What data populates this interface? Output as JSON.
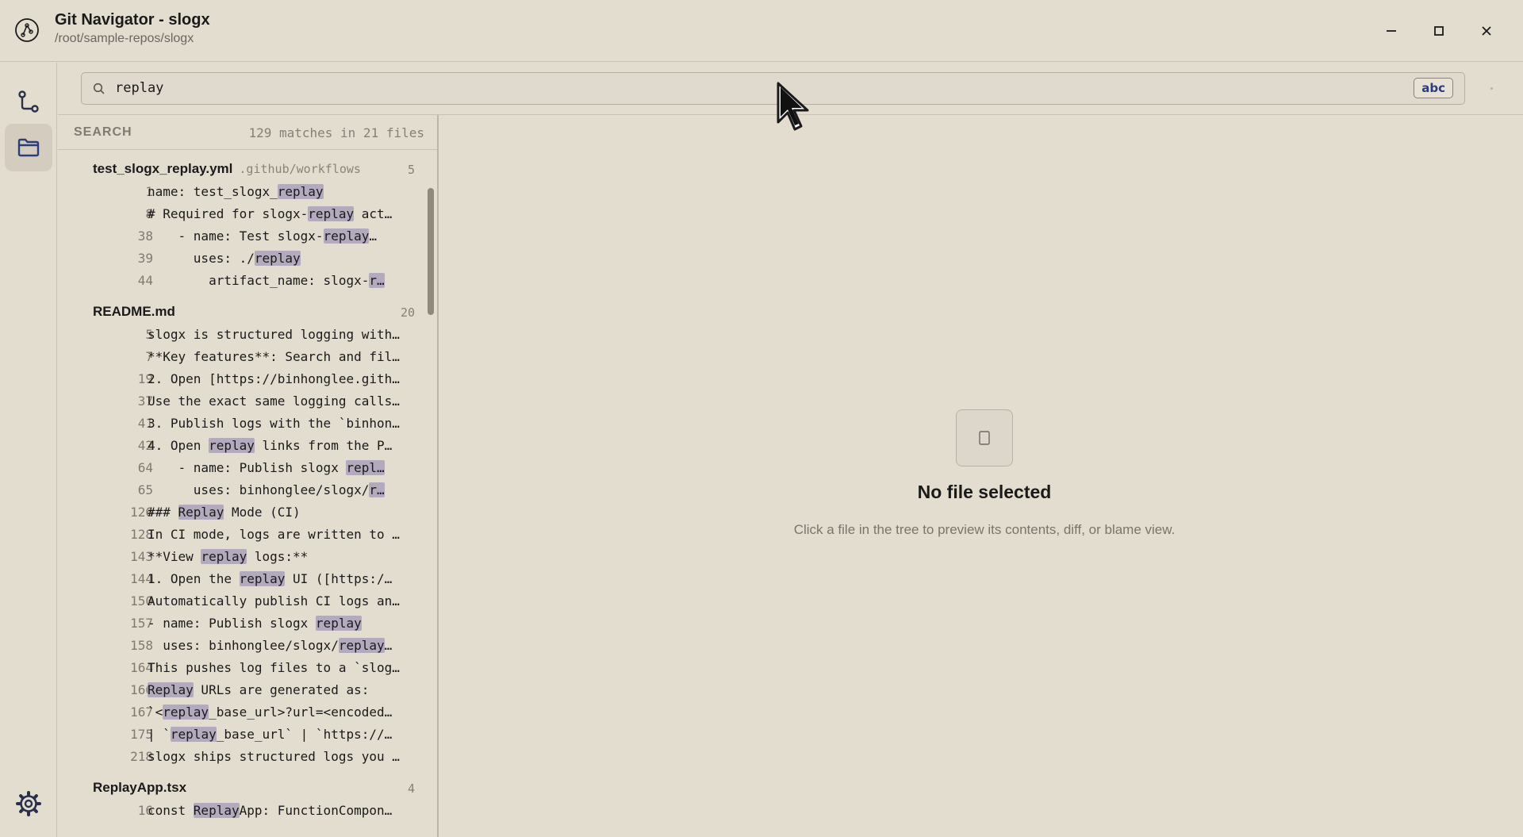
{
  "window": {
    "title": "Git Navigator - slogx",
    "path": "/root/sample-repos/slogx",
    "logo_icon": "git-navigator-logo-icon"
  },
  "rail": {
    "items": [
      {
        "icon": "git-branch-icon",
        "active": false
      },
      {
        "icon": "folder-icon",
        "active": true
      },
      {
        "icon": "gear-icon",
        "active": false
      }
    ]
  },
  "search": {
    "value": "replay",
    "case_toggle_label": "abc",
    "highlight_color": "#b3abbd"
  },
  "results": {
    "title": "SEARCH",
    "summary": "129 matches in 21 files",
    "files": [
      {
        "name": "test_slogx_replay.yml",
        "dir": ".github/workflows",
        "count": "5",
        "matches": [
          {
            "line": "1",
            "pre": "name: test_slogx_",
            "hl": "replay",
            "post": ""
          },
          {
            "line": "8",
            "pre": "# Required for slogx-",
            "hl": "replay",
            "post": " act…"
          },
          {
            "line": "38",
            "pre": "    - name: Test slogx-",
            "hl": "replay",
            "post": "…"
          },
          {
            "line": "39",
            "pre": "      uses: ./",
            "hl": "replay",
            "post": ""
          },
          {
            "line": "44",
            "pre": "        artifact_name: slogx-",
            "hl": "r…",
            "post": ""
          }
        ]
      },
      {
        "name": "README.md",
        "dir": "",
        "count": "20",
        "matches": [
          {
            "line": "5",
            "pre": "slogx is structured logging with…",
            "hl": "",
            "post": ""
          },
          {
            "line": "7",
            "pre": "**Key features**: Search and fil…",
            "hl": "",
            "post": ""
          },
          {
            "line": "19",
            "pre": "2. Open [https://binhonglee.gith…",
            "hl": "",
            "post": ""
          },
          {
            "line": "37",
            "pre": "Use the exact same logging calls…",
            "hl": "",
            "post": ""
          },
          {
            "line": "41",
            "pre": "3. Publish logs with the `binhon…",
            "hl": "",
            "post": ""
          },
          {
            "line": "42",
            "pre": "4. Open ",
            "hl": "replay",
            "post": " links from the P…"
          },
          {
            "line": "64",
            "pre": "    - name: Publish slogx ",
            "hl": "repl…",
            "post": ""
          },
          {
            "line": "65",
            "pre": "      uses: binhonglee/slogx/",
            "hl": "r…",
            "post": ""
          },
          {
            "line": "126",
            "pre": "### ",
            "hl": "Replay",
            "post": " Mode (CI)"
          },
          {
            "line": "128",
            "pre": "In CI mode, logs are written to …",
            "hl": "",
            "post": ""
          },
          {
            "line": "143",
            "pre": "**View ",
            "hl": "replay",
            "post": " logs:**"
          },
          {
            "line": "144",
            "pre": "1. Open the ",
            "hl": "replay",
            "post": " UI ([https:/…"
          },
          {
            "line": "150",
            "pre": "Automatically publish CI logs an…",
            "hl": "",
            "post": ""
          },
          {
            "line": "157",
            "pre": "- name: Publish slogx ",
            "hl": "replay",
            "post": ""
          },
          {
            "line": "158",
            "pre": "  uses: binhonglee/slogx/",
            "hl": "replay",
            "post": "…"
          },
          {
            "line": "164",
            "pre": "This pushes log files to a `slog…",
            "hl": "",
            "post": ""
          },
          {
            "line": "166",
            "pre": "",
            "hl": "Replay",
            "post": " URLs are generated as:"
          },
          {
            "line": "167",
            "pre": "`<",
            "hl": "replay",
            "post": "_base_url>?url=<encoded…"
          },
          {
            "line": "175",
            "pre": "| `",
            "hl": "replay",
            "post": "_base_url` | `https://…"
          },
          {
            "line": "218",
            "pre": "slogx ships structured logs you …",
            "hl": "",
            "post": ""
          }
        ]
      },
      {
        "name": "ReplayApp.tsx",
        "dir": "",
        "count": "4",
        "matches": [
          {
            "line": "16",
            "pre": "const ",
            "hl": "Replay",
            "post": "App: FunctionCompon…"
          }
        ]
      }
    ]
  },
  "preview": {
    "empty_icon": "file-icon",
    "empty_title": "No file selected",
    "empty_subtitle": "Click a file in the tree to preview its contents, diff, or blame view."
  }
}
